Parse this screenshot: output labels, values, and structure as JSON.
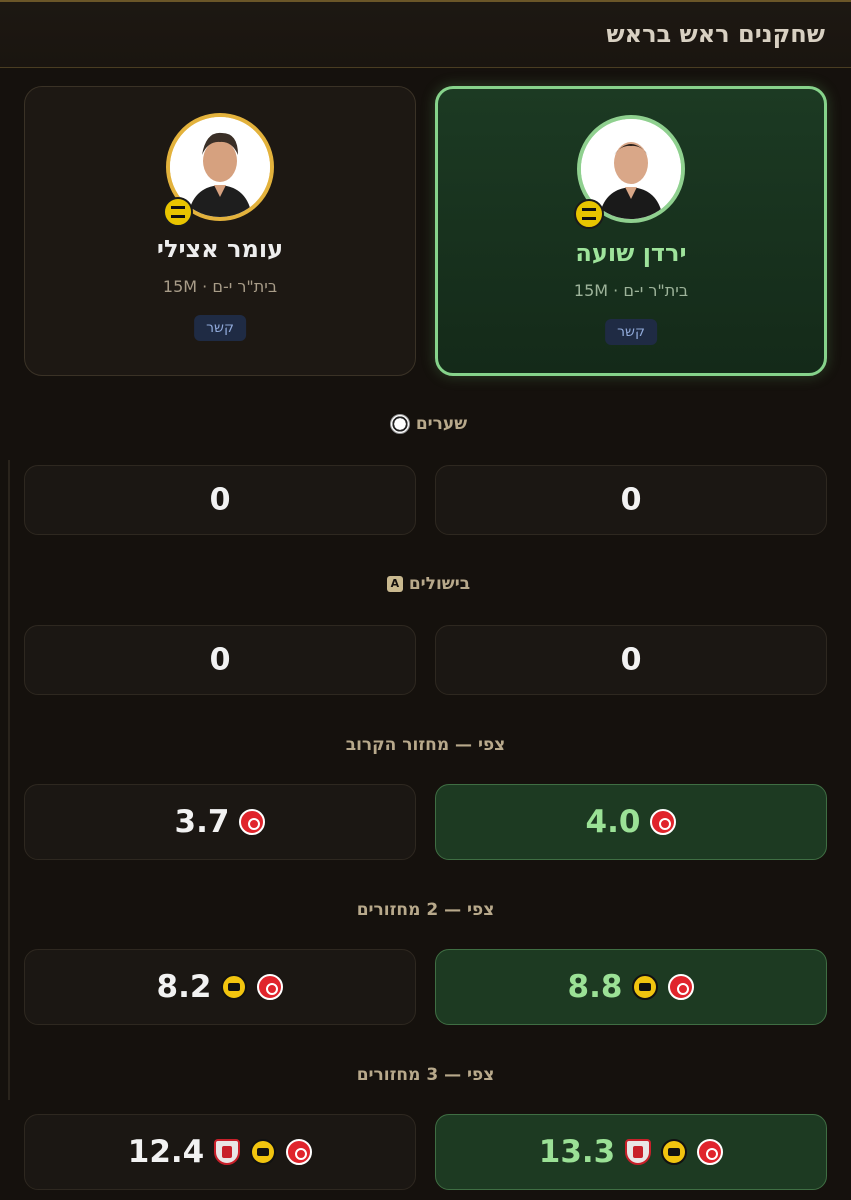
{
  "header": {
    "title": "שחקנים ראש בראש"
  },
  "players": [
    {
      "name": "ירדן שועה",
      "meta": "בית\"ר י-ם · 15M",
      "position": "קשר",
      "avatar_icon": "player-photo",
      "club_icon": "beitar-logo-icon"
    },
    {
      "name": "עומר אצילי",
      "meta": "בית\"ר י-ם · 15M",
      "position": "קשר",
      "avatar_icon": "player-photo",
      "club_icon": "beitar-logo-icon"
    }
  ],
  "sections": {
    "goals": {
      "label": "שערים",
      "icon": "soccer-ball-icon",
      "right": "0",
      "left": "0"
    },
    "assists": {
      "label": "בישולים",
      "icon": "assist-icon",
      "right": "0",
      "left": "0"
    },
    "last_round": {
      "label": "צפי — מחזור הקרוב",
      "right": "4.0",
      "left": "3.7"
    },
    "two_rounds": {
      "label": "צפי — 2 מחזורים",
      "right": "8.8",
      "left": "8.2"
    },
    "three_rounds": {
      "label": "צפי — 3 מחזורים",
      "right": "13.3",
      "left": "12.4"
    }
  },
  "colors": {
    "accent_green": "#86d38b",
    "gold": "#e3b23c",
    "background": "#15110d"
  }
}
